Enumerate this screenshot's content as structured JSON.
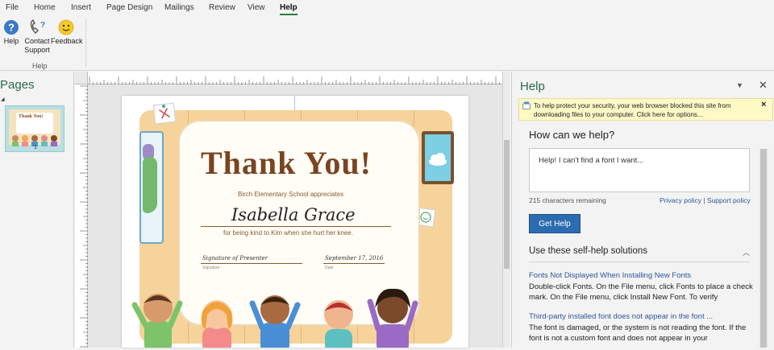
{
  "ribbon": {
    "tabs": [
      "File",
      "Home",
      "Insert",
      "Page Design",
      "Mailings",
      "Review",
      "View",
      "Help"
    ],
    "active_tab": "Help",
    "buttons": {
      "help": "Help",
      "contact_line1": "Contact",
      "contact_line2": "Support",
      "feedback": "Feedback"
    },
    "group_label": "Help"
  },
  "pages_panel": {
    "title": "Pages",
    "thumb_title": "Thank You!",
    "thumb_number": "1"
  },
  "certificate": {
    "title": "Thank You!",
    "school_line": "Birch Elementary School appreciates",
    "recipient": "Isabella Grace",
    "reason": "for being kind to Kim when she hurt her knee.",
    "signature_text": "Signature of Presenter",
    "signature_label": "Signature",
    "date_text": "September 17, 2016",
    "date_label": "Date"
  },
  "help_pane": {
    "title": "Help",
    "security_text": "To help protect your security, your web browser blocked this site from downloading files to your computer. Click here for options...",
    "security_close": "×",
    "how_heading": "How can we help?",
    "query_value": "Help! I can't find a font I want...",
    "remaining": "215 characters remaining",
    "privacy_link": "Privacy policy",
    "separator": " | ",
    "support_link": "Support policy",
    "get_help": "Get Help",
    "selfhelp_heading": "Use these self-help solutions",
    "results": [
      {
        "title": "Fonts Not Displayed When Installing New Fonts",
        "body": "Double-click Fonts. On the File menu, click Fonts to place a check mark. On the File menu, click Install New Font. To verify"
      },
      {
        "title": "Third-party installed font does not appear in the font ...",
        "body": "The font is damaged, or the system is not reading the font. If the font is not a custom font and does not appear in your"
      }
    ]
  },
  "colors": {
    "accent_green": "#2b6b4c",
    "link_blue": "#2b5797",
    "button_blue": "#2b6cb0",
    "certificate_brown": "#7a4421"
  }
}
